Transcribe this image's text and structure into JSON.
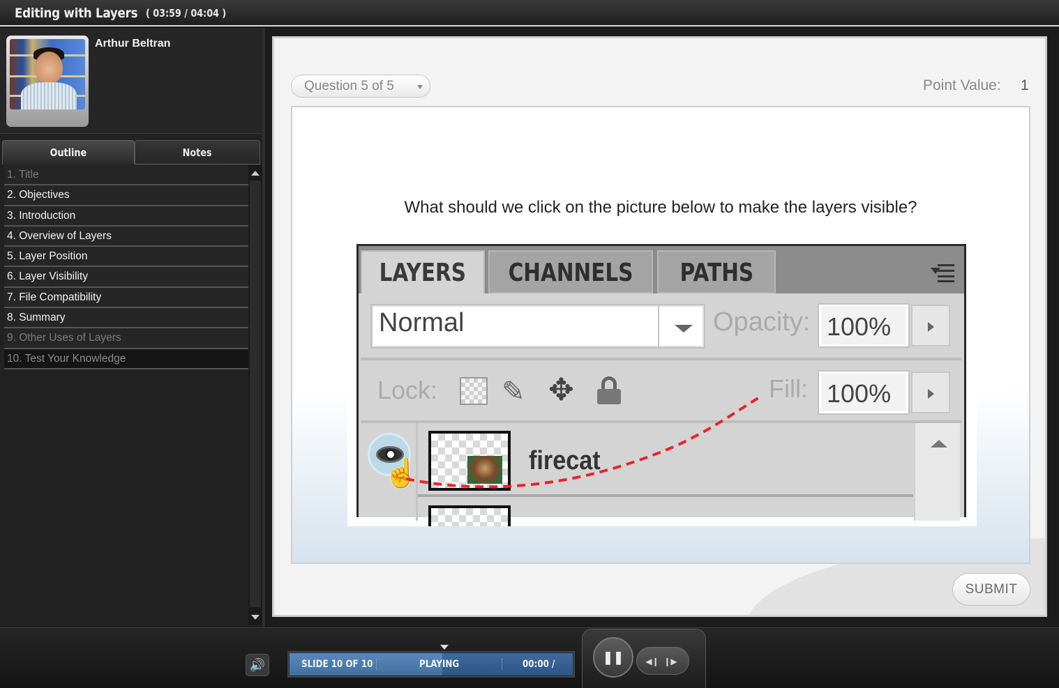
{
  "window": {
    "title": "Editing with Layers",
    "time": "( 03:59 / 04:04 )"
  },
  "presenter": {
    "name": "Arthur Beltran"
  },
  "tabs": {
    "outline": "Outline",
    "notes": "Notes"
  },
  "outline": [
    "1. Title",
    "2. Objectives",
    "3. Introduction",
    "4. Overview of Layers",
    "5. Layer Position",
    "6. Layer Visibility",
    "7. File Compatibility",
    "8. Summary",
    "9. Other Uses of Layers",
    "10. Test Your Knowledge"
  ],
  "quiz": {
    "question_selector": "Question 5 of 5",
    "point_value_label": "Point Value:",
    "point_value": "1",
    "prompt": "What should we click on the picture below to make the layers visible?",
    "submit_label": "SUBMIT"
  },
  "layers_panel": {
    "tabs": [
      "LAYERS",
      "CHANNELS",
      "PATHS"
    ],
    "blend_mode": "Normal",
    "opacity_label": "Opacity:",
    "opacity": "100%",
    "lock_label": "Lock:",
    "fill_label": "Fill:",
    "fill": "100%",
    "layer_name": "firecat",
    "guide_color": "#e8242a"
  },
  "player": {
    "slide": "SLIDE 10 OF 10",
    "status": "PLAYING",
    "timer": "00:00 /",
    "progress": 0.54
  },
  "colors": {
    "accent": "#4a77ab"
  }
}
